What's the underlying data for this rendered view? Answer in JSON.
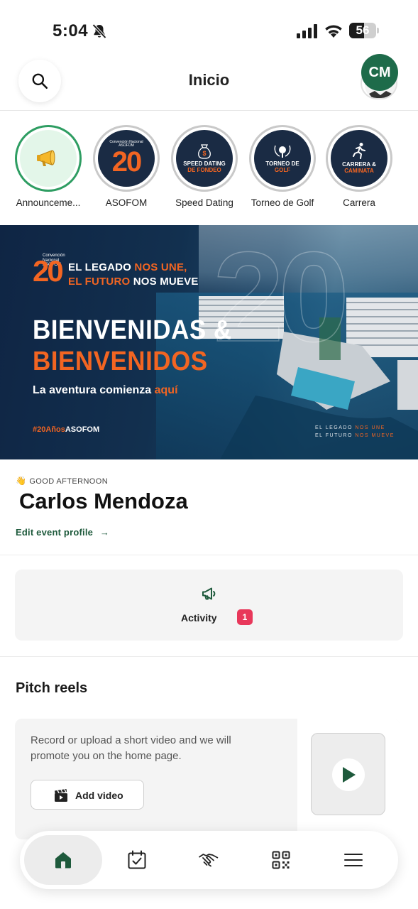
{
  "status_bar": {
    "time": "5:04",
    "battery": "56",
    "battery_level": 0.56,
    "icons": [
      "bell-slash-icon",
      "cellular-signal-icon",
      "wifi-icon",
      "battery-icon"
    ]
  },
  "header": {
    "title": "Inicio",
    "search_icon": "search-icon",
    "avatar_initials": "CM"
  },
  "stories": [
    {
      "label": "Announceme...",
      "icon": "megaphone-icon",
      "active": true
    },
    {
      "label": "ASOFOM",
      "num": "20",
      "top": "Convención Nacional ASOFOM"
    },
    {
      "label": "Speed Dating",
      "line1": "SPEED DATING",
      "line2": "DE FONDEO",
      "icon": "money-bag-icon"
    },
    {
      "label": "Torneo de Golf",
      "line1": "TORNEO DE",
      "line2": "GOLF",
      "icon": "golf-icon"
    },
    {
      "label": "Carrera",
      "line1": "CARRERA &",
      "line2": "CAMINATA",
      "icon": "runner-icon"
    }
  ],
  "banner": {
    "logo_num": "20",
    "logo_top": "Convención Nacional ASOFOM",
    "tag_line1_a": "EL LEGADO ",
    "tag_line1_b": "NOS UNE,",
    "tag_line2_a": "EL FUTURO ",
    "tag_line2_b": "NOS MUEVE",
    "heading1": "BIENVENIDAS &",
    "heading2": "BIENVENIDOS",
    "subtitle_a": "La aventura comienza ",
    "subtitle_b": "aquí",
    "hashtag_a": "#20Años",
    "hashtag_b": "ASOFOM",
    "footer_line1_a": "EL LEGADO ",
    "footer_line1_b": "NOS UNE",
    "footer_line2_a": "EL FUTURO ",
    "footer_line2_b": "NOS MUEVE"
  },
  "greeting": {
    "emoji": "👋",
    "label": "GOOD AFTERNOON",
    "name": "Carlos Mendoza",
    "edit_link": "Edit event profile",
    "edit_arrow": "→"
  },
  "activity": {
    "label": "Activity",
    "badge": "1",
    "icon": "megaphone-icon"
  },
  "pitch_reels": {
    "title": "Pitch reels",
    "description": "Record or upload a short video and we will promote you on the home page.",
    "button_label": "Add video",
    "button_icon": "clapperboard-icon",
    "thumb_icon": "play-icon"
  },
  "bottom_nav": [
    {
      "name": "home",
      "icon": "home-icon",
      "active": true
    },
    {
      "name": "agenda",
      "icon": "calendar-check-icon"
    },
    {
      "name": "networking",
      "icon": "handshake-icon"
    },
    {
      "name": "qr",
      "icon": "qr-code-icon"
    },
    {
      "name": "menu",
      "icon": "menu-icon"
    }
  ],
  "colors": {
    "brand_green": "#1e5a3c",
    "brand_orange": "#f26522",
    "navy": "#1a2b44",
    "badge_pink": "#e8375a"
  }
}
